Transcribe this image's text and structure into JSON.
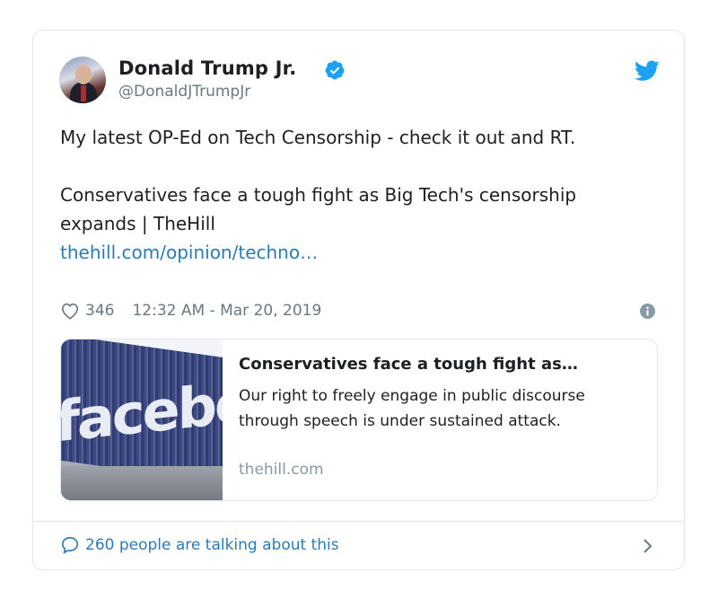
{
  "author": {
    "name": "Donald Trump Jr.",
    "handle": "@DonaldJTrumpJr",
    "verified_icon": "verified-badge-icon",
    "avatar_icon": "avatar"
  },
  "tweet": {
    "text_line1": "My latest OP-Ed on Tech Censorship - check it out and RT.",
    "text_line2": "Conservatives face a tough fight as Big Tech's censorship expands | TheHill",
    "link_text": "thehill.com/opinion/techno…",
    "likes": "346",
    "timestamp": "12:32 AM - Mar 20, 2019"
  },
  "link_card": {
    "title": "Conservatives face a tough fight as…",
    "description": "Our right to freely engage in public discourse through speech is under sustained attack.",
    "domain": "thehill.com",
    "thumbnail_text": "facebook"
  },
  "footer": {
    "talking_text": "260 people are talking about this"
  },
  "colors": {
    "link": "#2b7bb9",
    "twitter_blue": "#1da1f2",
    "text": "#1c2022",
    "muted": "#697882"
  }
}
